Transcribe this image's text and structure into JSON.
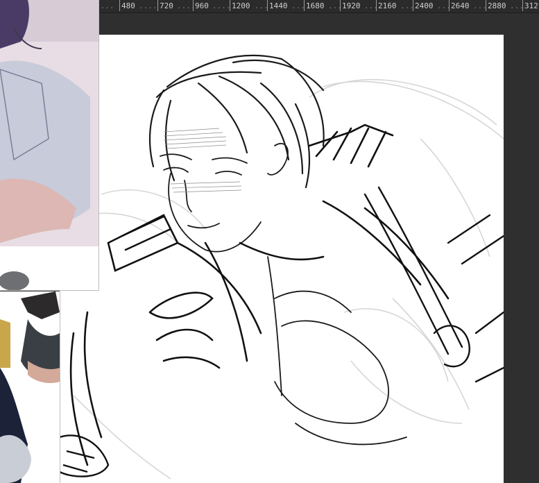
{
  "ruler": {
    "ticks": [
      "480",
      "720",
      "960",
      "1200",
      "1440",
      "1680",
      "1920",
      "2160",
      "2400",
      "2640",
      "2880",
      "312"
    ]
  },
  "canvas": {
    "content": "sketch-drawing"
  },
  "reference_panels": [
    {
      "name": "reference-image-top"
    },
    {
      "name": "reference-image-bottom"
    }
  ]
}
